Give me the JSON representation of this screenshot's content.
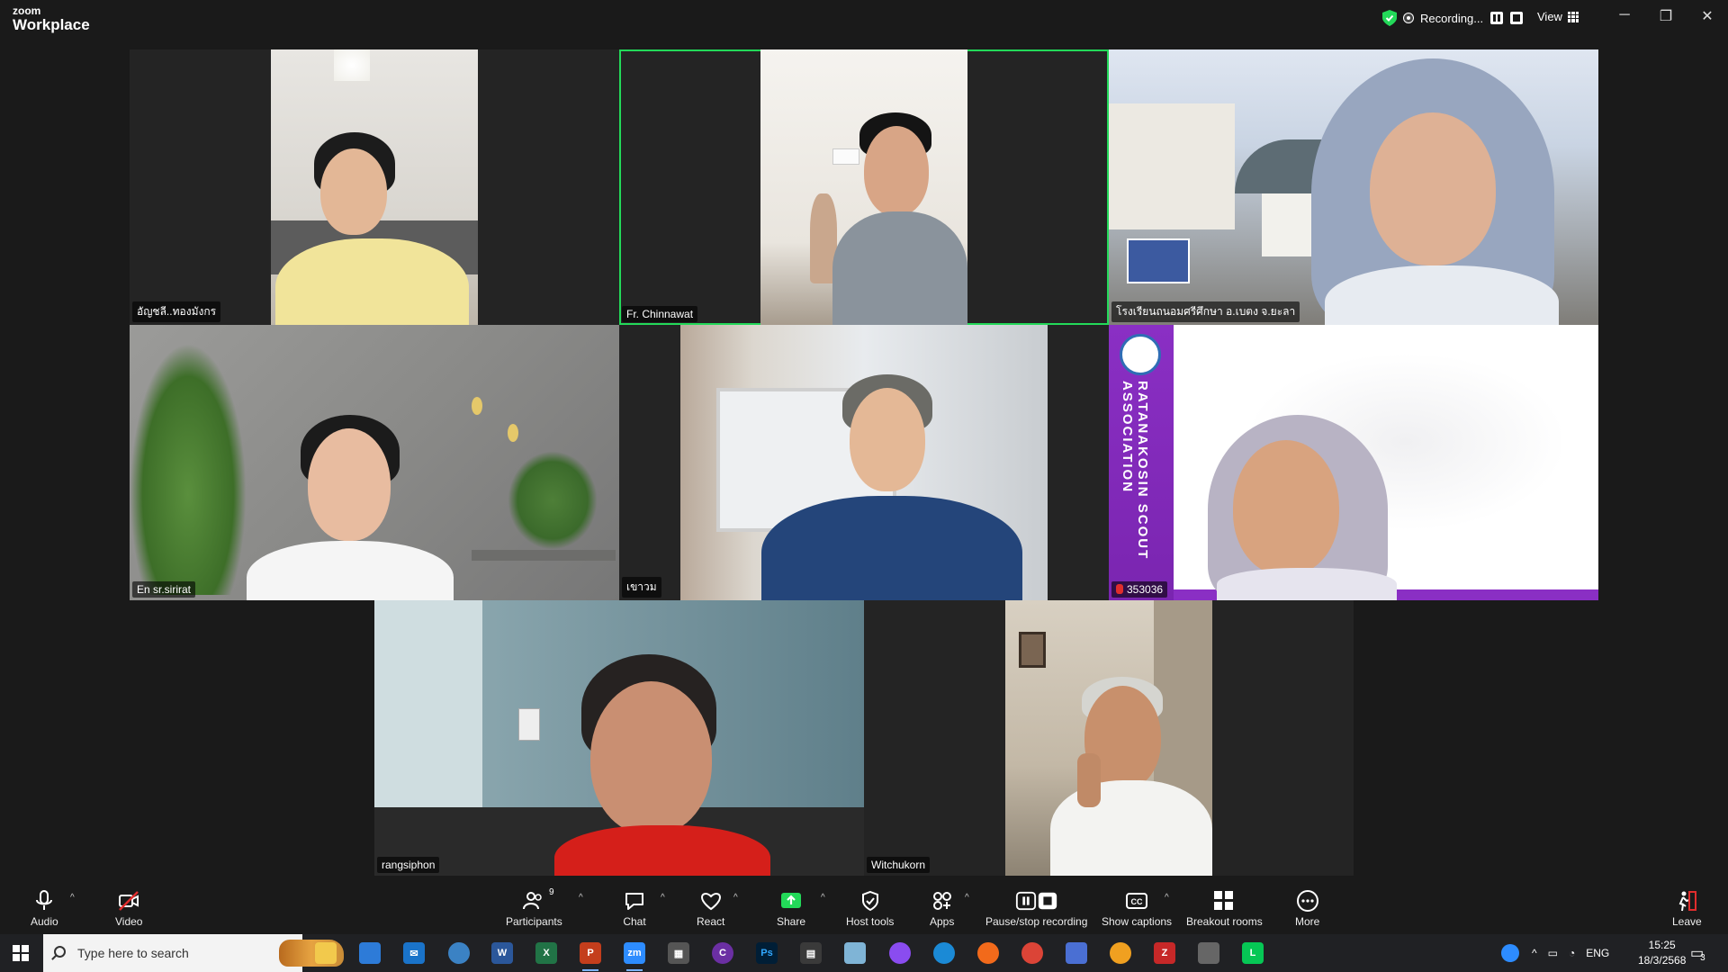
{
  "app": {
    "brand_line1": "zoom",
    "brand_line2": "Workplace"
  },
  "recording": {
    "label": "Recording..."
  },
  "view": {
    "label": "View"
  },
  "participants": [
    {
      "name": "อัญชลี..ทองมังกร",
      "active": false
    },
    {
      "name": "Fr. Chinnawat",
      "active": true
    },
    {
      "name": "โรงเรียนถนอมศรีศึกษา อ.เบตง จ.ยะลา",
      "active": false
    },
    {
      "name": "En sr.sirirat",
      "active": false
    },
    {
      "name": "เขาวม",
      "active": false
    },
    {
      "name": "353036",
      "active": false,
      "muted": true
    },
    {
      "name": "rangsiphon",
      "active": false
    },
    {
      "name": "Witchukorn",
      "active": false
    }
  ],
  "scout_banner": {
    "text": "RATANAKOSIN SCOUT ASSOCIATION"
  },
  "toolbar": {
    "audio": "Audio",
    "video": "Video",
    "participants": "Participants",
    "participants_count": "9",
    "chat": "Chat",
    "react": "React",
    "share": "Share",
    "host_tools": "Host tools",
    "apps": "Apps",
    "pause_recording": "Pause/stop recording",
    "captions": "Show captions",
    "breakout": "Breakout rooms",
    "more": "More",
    "leave": "Leave"
  },
  "taskbar": {
    "search_placeholder": "Type here to search",
    "language": "ENG",
    "time": "15:25",
    "date": "18/3/2568",
    "notifications": "3"
  },
  "colors": {
    "active_speaker": "#23d959",
    "share_green": "#23d959",
    "scout_purple": "#8a2fc4"
  }
}
